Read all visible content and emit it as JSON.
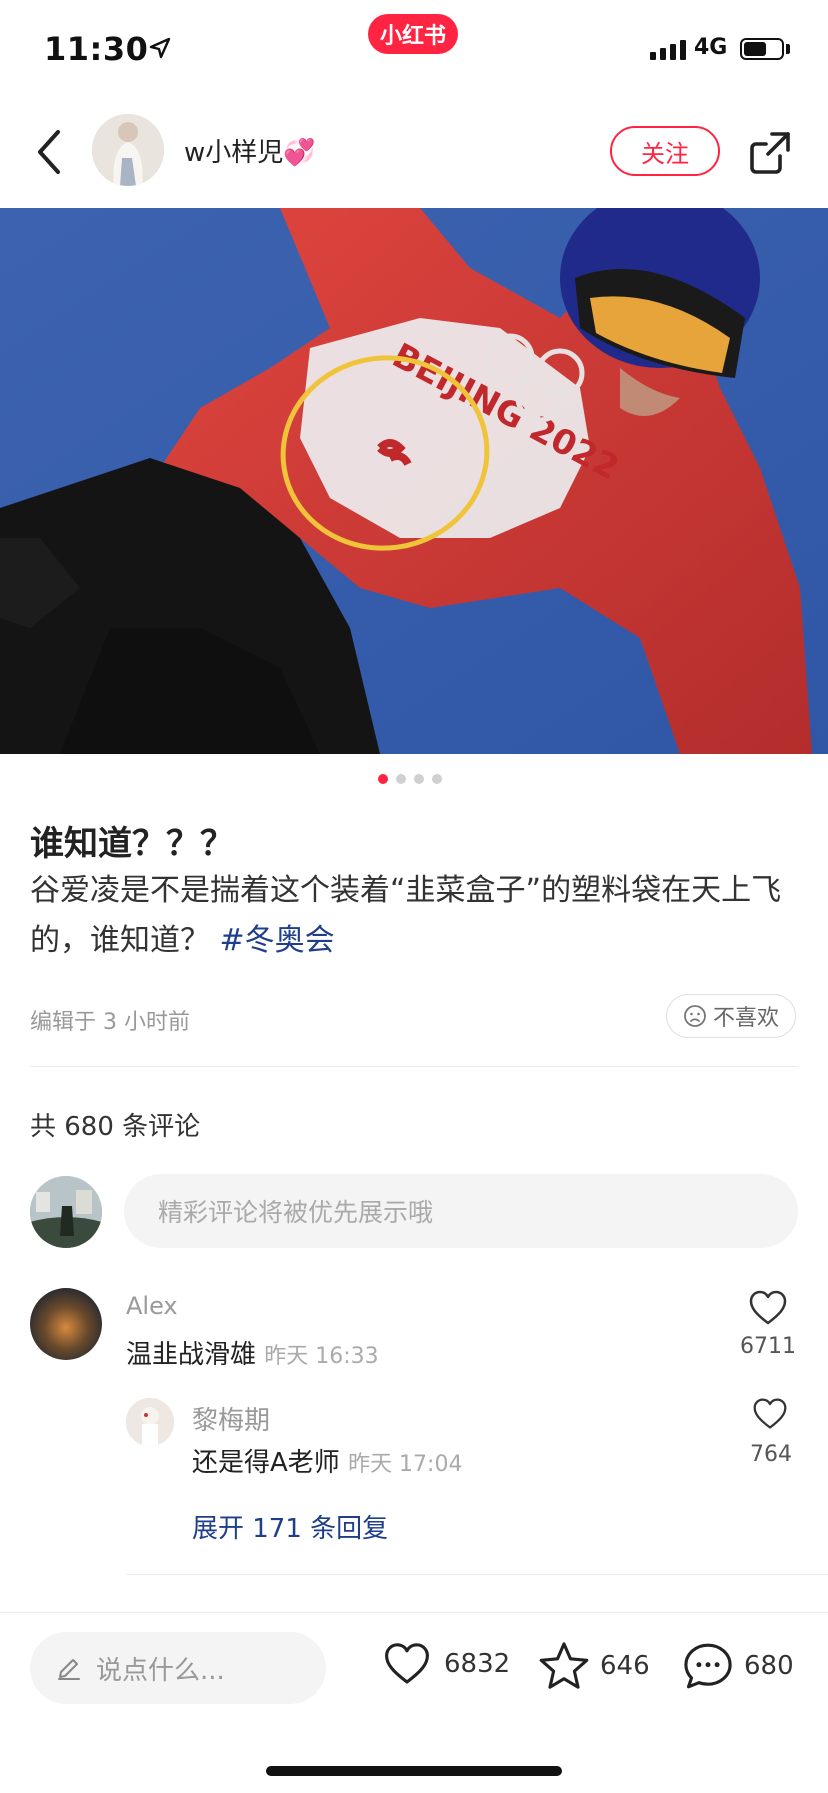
{
  "status_bar": {
    "time": "11:30",
    "app_badge": "小红书",
    "network": "4G"
  },
  "header": {
    "username": "w小样児💞",
    "follow_label": "关注"
  },
  "photo": {
    "page_count": 4,
    "active_page": 1,
    "jersey_text": "BEIJING 2022"
  },
  "post": {
    "title": "谁知道？？？",
    "body_text": "谷爱凌是不是揣着这个装着“韭菜盒子”的塑料袋在天上飞的，谁知道？",
    "hashtag": "#冬奥会",
    "edit_time": "编辑于 3 小时前",
    "dislike_label": "不喜欢"
  },
  "comments_section": {
    "count_label": "共 680 条评论",
    "input_placeholder": "精彩评论将被优先展示哦",
    "comments": [
      {
        "author": "Alex",
        "text": "温韭战滑雄",
        "time": "昨天 16:33",
        "likes": "6711",
        "replies": [
          {
            "author": "黎梅期",
            "text": "还是得A老师",
            "time": "昨天 17:04",
            "likes": "764"
          }
        ],
        "expand_label": "展开 171 条回复"
      }
    ]
  },
  "bottom_bar": {
    "input_placeholder": "说点什么...",
    "like_count": "6832",
    "favorite_count": "646",
    "comment_count": "680"
  },
  "colors": {
    "brand": "#ff2442",
    "hashtag": "#1f3f8a"
  }
}
